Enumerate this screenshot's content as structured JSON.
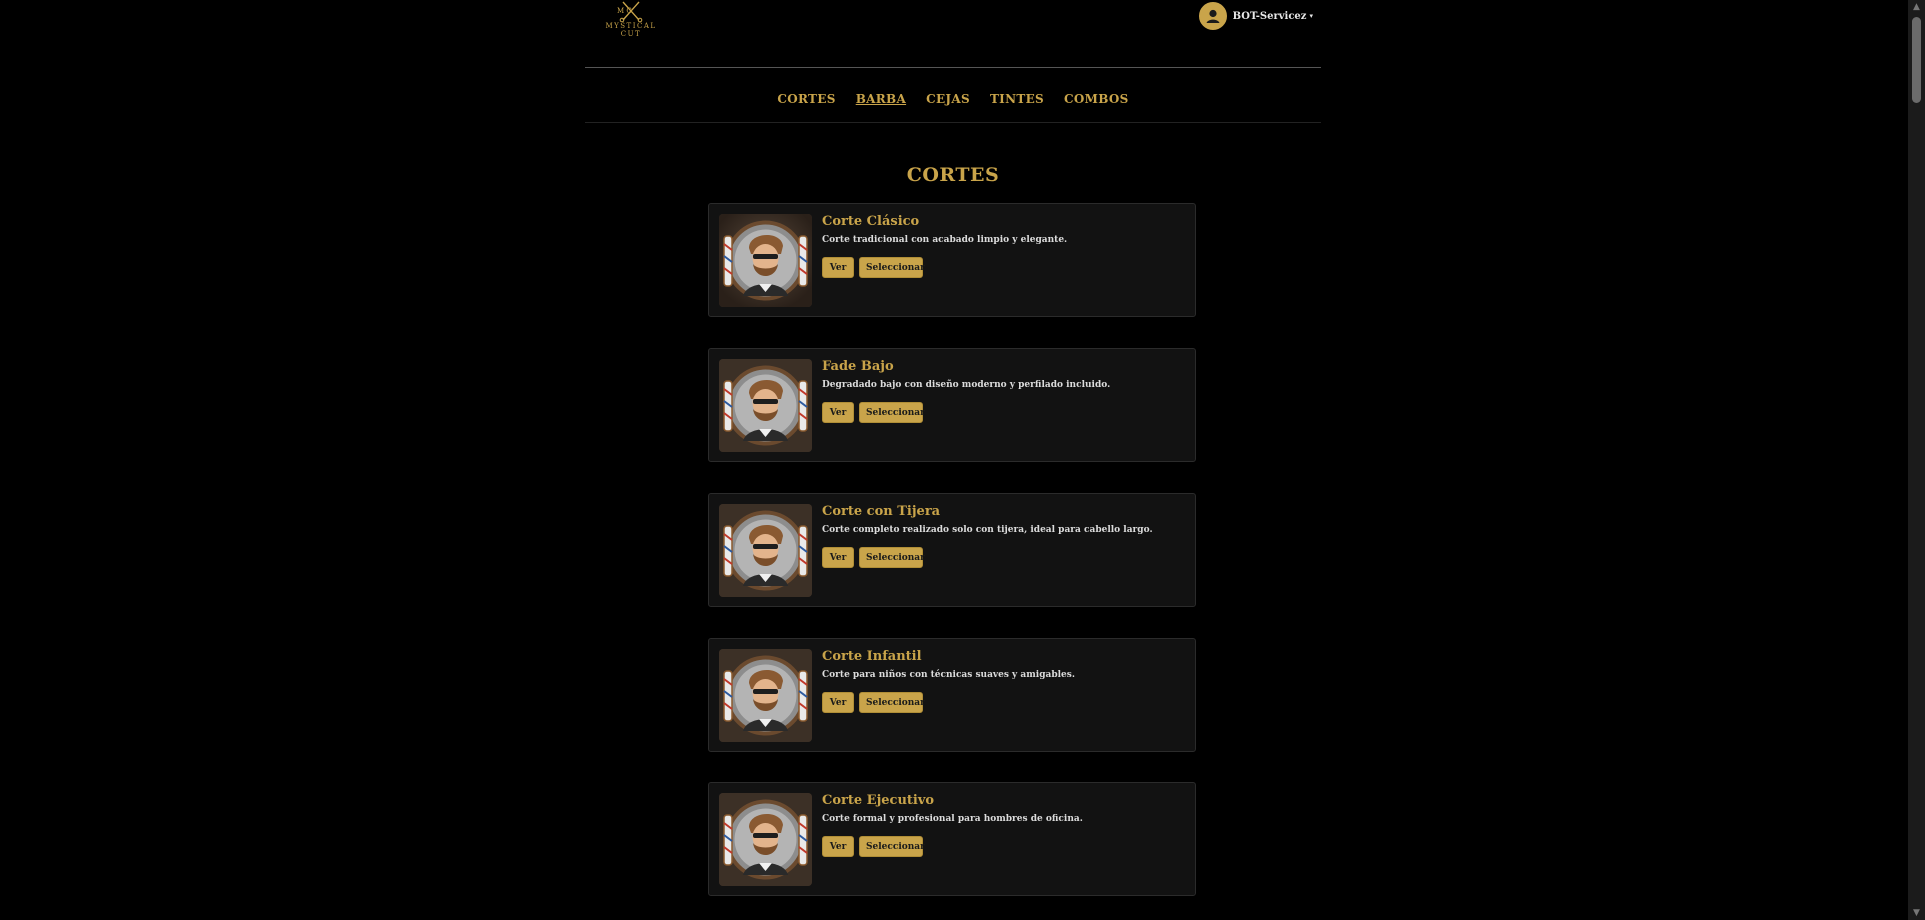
{
  "header": {
    "logo_initials": "M  C",
    "logo_line1": "MYSTICAL",
    "logo_line2": "CUT",
    "user_name": "BOT-Servicez",
    "caret": "▾"
  },
  "nav": {
    "items": [
      {
        "label": "CORTES",
        "active": false
      },
      {
        "label": "BARBA",
        "active": true
      },
      {
        "label": "CEJAS",
        "active": false
      },
      {
        "label": "TINTES",
        "active": false
      },
      {
        "label": "COMBOS",
        "active": false
      }
    ]
  },
  "section": {
    "title": "CORTES"
  },
  "services": [
    {
      "title": "Corte Clásico",
      "description": "Corte tradicional con acabado limpio y elegante.",
      "view_label": "Ver",
      "select_label": "Seleccionar"
    },
    {
      "title": "Fade Bajo",
      "description": "Degradado bajo con diseño moderno y perfilado incluido.",
      "view_label": "Ver",
      "select_label": "Seleccionar"
    },
    {
      "title": "Corte con Tijera",
      "description": "Corte completo realizado solo con tijera, ideal para cabello largo.",
      "view_label": "Ver",
      "select_label": "Seleccionar"
    },
    {
      "title": "Corte Infantil",
      "description": "Corte para niños con técnicas suaves y amigables.",
      "view_label": "Ver",
      "select_label": "Seleccionar"
    },
    {
      "title": "Corte Ejecutivo",
      "description": "Corte formal y profesional para hombres de oficina.",
      "view_label": "Ver",
      "select_label": "Seleccionar"
    }
  ],
  "scrollbar": {
    "up_arrow": "▲",
    "down_arrow": "▼"
  },
  "colors": {
    "accent": "#c9a44a",
    "background": "#000000",
    "card": "#121212"
  }
}
